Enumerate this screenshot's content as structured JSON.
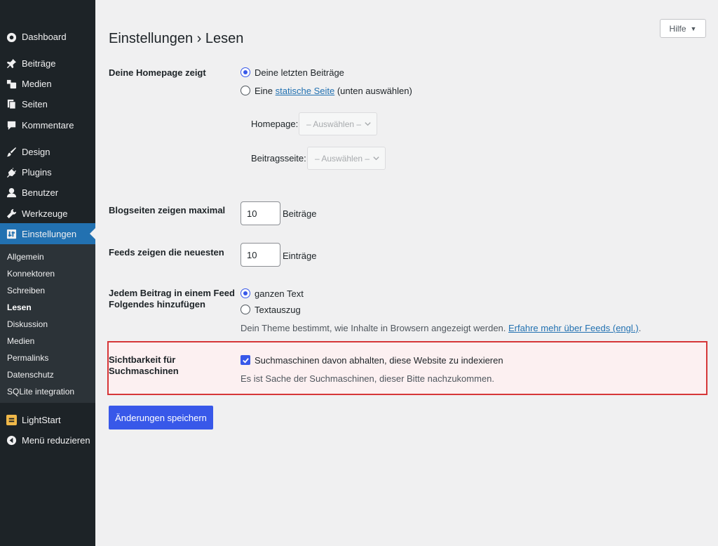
{
  "sidebar": {
    "items": [
      {
        "label": "Dashboard",
        "icon": "dashboard-icon"
      },
      {
        "label": "Beiträge",
        "icon": "pin-icon"
      },
      {
        "label": "Medien",
        "icon": "media-icon"
      },
      {
        "label": "Seiten",
        "icon": "pages-icon"
      },
      {
        "label": "Kommentare",
        "icon": "comment-icon"
      },
      {
        "label": "Design",
        "icon": "brush-icon"
      },
      {
        "label": "Plugins",
        "icon": "plug-icon"
      },
      {
        "label": "Benutzer",
        "icon": "user-icon"
      },
      {
        "label": "Werkzeuge",
        "icon": "wrench-icon"
      },
      {
        "label": "Einstellungen",
        "icon": "settings-icon"
      }
    ],
    "submenu": [
      "Allgemein",
      "Konnektoren",
      "Schreiben",
      "Lesen",
      "Diskussion",
      "Medien",
      "Permalinks",
      "Datenschutz",
      "SQLite integration"
    ],
    "lightstart": "LightStart",
    "collapse": "Menü reduzieren"
  },
  "header": {
    "help_label": "Hilfe",
    "title": "Einstellungen › Lesen"
  },
  "homepage": {
    "label": "Deine Homepage zeigt",
    "option_latest": "Deine letzten Beiträge",
    "option_static_prefix": "Eine",
    "option_static_link": "statische Seite",
    "option_static_suffix": "(unten auswählen)",
    "homepage_label": "Homepage:",
    "homepage_select": "– Auswählen –",
    "postspage_label": "Beitragsseite:",
    "postspage_select": "– Auswählen –"
  },
  "blog_pages": {
    "label": "Blogseiten zeigen maximal",
    "value": "10",
    "unit": "Beiträge"
  },
  "feeds": {
    "label": "Feeds zeigen die neuesten",
    "value": "10",
    "unit": "Einträge"
  },
  "feed_content": {
    "label": "Jedem Beitrag in einem Feed Folgendes hinzufügen",
    "option_full": "ganzen Text",
    "option_excerpt": "Textauszug",
    "hint": "Dein Theme bestimmt, wie Inhalte in Browsern angezeigt werden.",
    "hint_link": "Erfahre mehr über Feeds (engl.)",
    "hint_end": "."
  },
  "visibility": {
    "label": "Sichtbarkeit für Suchmaschinen",
    "checkbox_label": "Suchmaschinen davon abhalten, diese Website zu indexieren",
    "hint": "Es ist Sache der Suchmaschinen, dieser Bitte nachzukommen."
  },
  "save_label": "Änderungen speichern",
  "colors": {
    "sidebar_bg": "#1d2327",
    "accent": "#3858e9",
    "active_menu": "#2271b1",
    "highlight_border": "#d63638"
  }
}
